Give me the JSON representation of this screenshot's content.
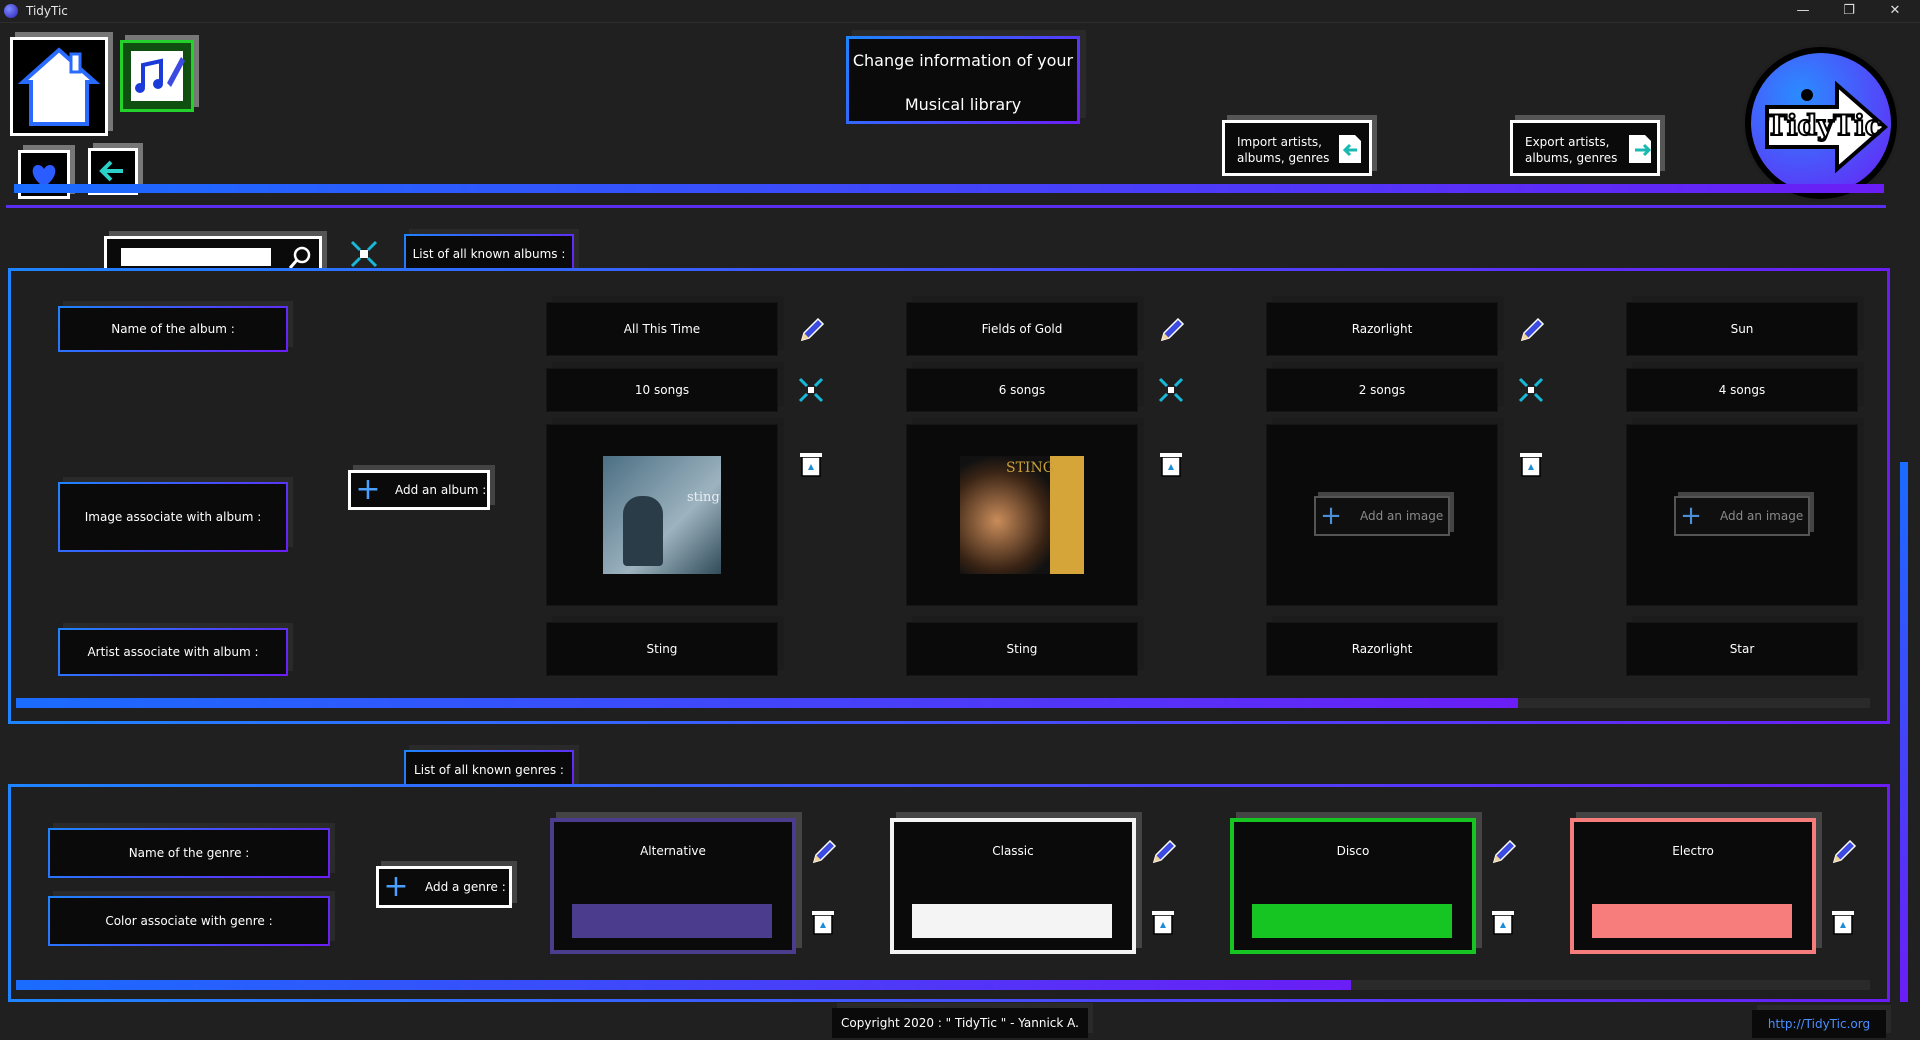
{
  "window": {
    "title": "TidyTic",
    "controls": [
      "—",
      "❐",
      "✕"
    ]
  },
  "header": {
    "title_line1": "Change information of your",
    "title_line2": "Musical library",
    "import_label_1": "Import artists,",
    "import_label_2": "albums, genres",
    "export_label_1": "Export artists,",
    "export_label_2": "albums, genres",
    "logo_text": "TidyTic"
  },
  "albums_section": {
    "tab_label": "List of all known albums :",
    "search_value": "",
    "row_labels": {
      "name": "Name of the album :",
      "image": "Image associate with album :",
      "artist": "Artist associate with album :"
    },
    "add_album_label": "Add an album :",
    "add_image_label": "Add an image",
    "scroll_progress": 0.81,
    "albums": [
      {
        "name": "All This Time",
        "songs": "10 songs",
        "artist": "Sting",
        "has_image": true,
        "cover_color": "#6d8da0"
      },
      {
        "name": "Fields of Gold",
        "songs": "6 songs",
        "artist": "Sting",
        "has_image": true,
        "cover_color": "#c9a036"
      },
      {
        "name": "Razorlight",
        "songs": "2 songs",
        "artist": "Razorlight",
        "has_image": false
      },
      {
        "name": "Sun",
        "songs": "4 songs",
        "artist": "Star",
        "has_image": false
      }
    ]
  },
  "genres_section": {
    "tab_label": "List of all known genres :",
    "row_labels": {
      "name": "Name of the genre :",
      "color": "Color associate with genre :"
    },
    "add_genre_label": "Add a genre :",
    "scroll_progress": 0.72,
    "genres": [
      {
        "name": "Alternative",
        "color": "#4b3c8e"
      },
      {
        "name": "Classic",
        "color": "#f4f4f4"
      },
      {
        "name": "Disco",
        "color": "#16c422"
      },
      {
        "name": "Electro",
        "color": "#f77c7c"
      }
    ]
  },
  "footer": {
    "copyright": "Copyright 2020 : \" TidyTic \" - Yannick A.",
    "url": "http://TidyTic.org"
  },
  "colors": {
    "accent_blue": "#1e84ff",
    "accent_purple": "#6a1ef5",
    "background": "#202020"
  }
}
